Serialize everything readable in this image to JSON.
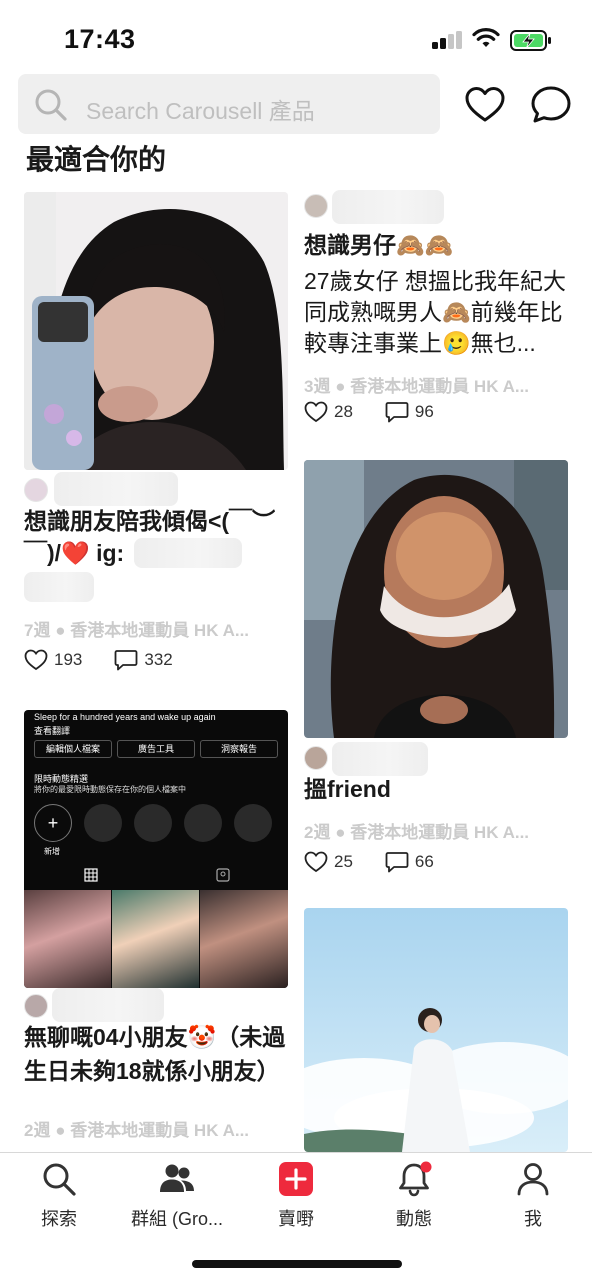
{
  "status_bar": {
    "time": "17:43"
  },
  "search": {
    "placeholder": "Search Carousell 產品"
  },
  "header_icons": [
    "heart-icon",
    "chat-icon"
  ],
  "section_title": "最適合你的",
  "listings": [
    {
      "title_line1": "想識朋友陪我傾偈<(￣︶",
      "title_line2": "￣)/❤️ ig:",
      "age": "7週",
      "category": "香港本地運動員 HK A...",
      "likes": "193",
      "comments": "332"
    },
    {
      "title": "想識男仔🙈🙈",
      "description": "27歲女仔 想搵比我年紀大同成熟嘅男人🙈前幾年比較專注事業上🥲無乜...",
      "age": "3週",
      "category": "香港本地運動員 HK A...",
      "likes": "28",
      "comments": "96"
    },
    {
      "title": "搵friend",
      "age": "2週",
      "category": "香港本地運動員 HK A...",
      "likes": "25",
      "comments": "66"
    },
    {
      "title_line1": "無聊嘅04小朋友🤡（未過",
      "title_line2": "生日未夠18就係小朋友）",
      "age": "2週",
      "category": "香港本地運動員 HK A...",
      "screenshot": {
        "bio": "Sleep for a hundred years and wake up again",
        "translate": "查看翻譯",
        "buttons": [
          "編輯個人檔案",
          "廣告工具",
          "洞察報告"
        ],
        "highlights_title": "限時動態精選",
        "highlights_sub": "將你的最愛限時動態保存在你的個人檔案中",
        "new_label": "新增"
      }
    }
  ],
  "bottom_nav": [
    {
      "label": "探索",
      "icon": "search-icon"
    },
    {
      "label": "群組 (Gro...",
      "icon": "groups-icon"
    },
    {
      "label": "賣嘢",
      "icon": "sell-plus-icon"
    },
    {
      "label": "動態",
      "icon": "bell-icon"
    },
    {
      "label": "我",
      "icon": "profile-icon"
    }
  ],
  "colors": {
    "brand_red": "#ee2a3d",
    "muted": "#cbcbcb",
    "search_bg": "#efefef"
  }
}
